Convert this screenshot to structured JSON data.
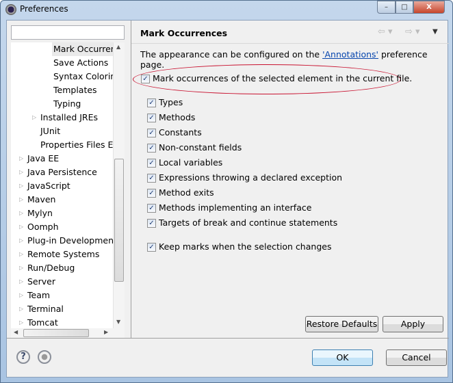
{
  "window": {
    "title": "Preferences",
    "minimize": "–",
    "maximize": "□",
    "close": "X"
  },
  "filter": {
    "value": "",
    "placeholder": ""
  },
  "tree": [
    {
      "label": "Mark Occurren",
      "level": 3,
      "selected": true
    },
    {
      "label": "Save Actions",
      "level": 3
    },
    {
      "label": "Syntax Coloring",
      "level": 3
    },
    {
      "label": "Templates",
      "level": 3
    },
    {
      "label": "Typing",
      "level": 3
    },
    {
      "label": "Installed JREs",
      "level": 2,
      "expandable": true
    },
    {
      "label": "JUnit",
      "level": 2
    },
    {
      "label": "Properties Files Ed",
      "level": 2
    },
    {
      "label": "Java EE",
      "level": 1,
      "expandable": true
    },
    {
      "label": "Java Persistence",
      "level": 1,
      "expandable": true
    },
    {
      "label": "JavaScript",
      "level": 1,
      "expandable": true
    },
    {
      "label": "Maven",
      "level": 1,
      "expandable": true
    },
    {
      "label": "Mylyn",
      "level": 1,
      "expandable": true
    },
    {
      "label": "Oomph",
      "level": 1,
      "expandable": true
    },
    {
      "label": "Plug-in Development",
      "level": 1,
      "expandable": true
    },
    {
      "label": "Remote Systems",
      "level": 1,
      "expandable": true
    },
    {
      "label": "Run/Debug",
      "level": 1,
      "expandable": true
    },
    {
      "label": "Server",
      "level": 1,
      "expandable": true
    },
    {
      "label": "Team",
      "level": 1,
      "expandable": true
    },
    {
      "label": "Terminal",
      "level": 1,
      "expandable": true
    },
    {
      "label": "Tomcat",
      "level": 1,
      "expandable": true
    }
  ],
  "page": {
    "title": "Mark Occurrences",
    "desc_before": "The appearance can be configured on the ",
    "desc_link": "'Annotations'",
    "desc_after": " preference page.",
    "main_option": {
      "label": "Mark occurrences of the selected element in the current file.",
      "checked": true
    },
    "options": [
      {
        "label": "Types",
        "checked": true
      },
      {
        "label": "Methods",
        "checked": true
      },
      {
        "label": "Constants",
        "checked": true
      },
      {
        "label": "Non-constant fields",
        "checked": true
      },
      {
        "label": "Local variables",
        "checked": true
      },
      {
        "label": "Expressions throwing a declared exception",
        "checked": true
      },
      {
        "label": "Method exits",
        "checked": true
      },
      {
        "label": "Methods implementing an interface",
        "checked": true
      },
      {
        "label": "Targets of break and continue statements",
        "checked": true
      }
    ],
    "keep_marks": {
      "label": "Keep marks when the selection changes",
      "checked": true
    },
    "restore_defaults": "Restore Defaults",
    "apply": "Apply"
  },
  "footer": {
    "ok": "OK",
    "cancel": "Cancel",
    "help": "?"
  },
  "colors": {
    "highlight_ellipse": "#c8102e",
    "link": "#0645ad"
  }
}
